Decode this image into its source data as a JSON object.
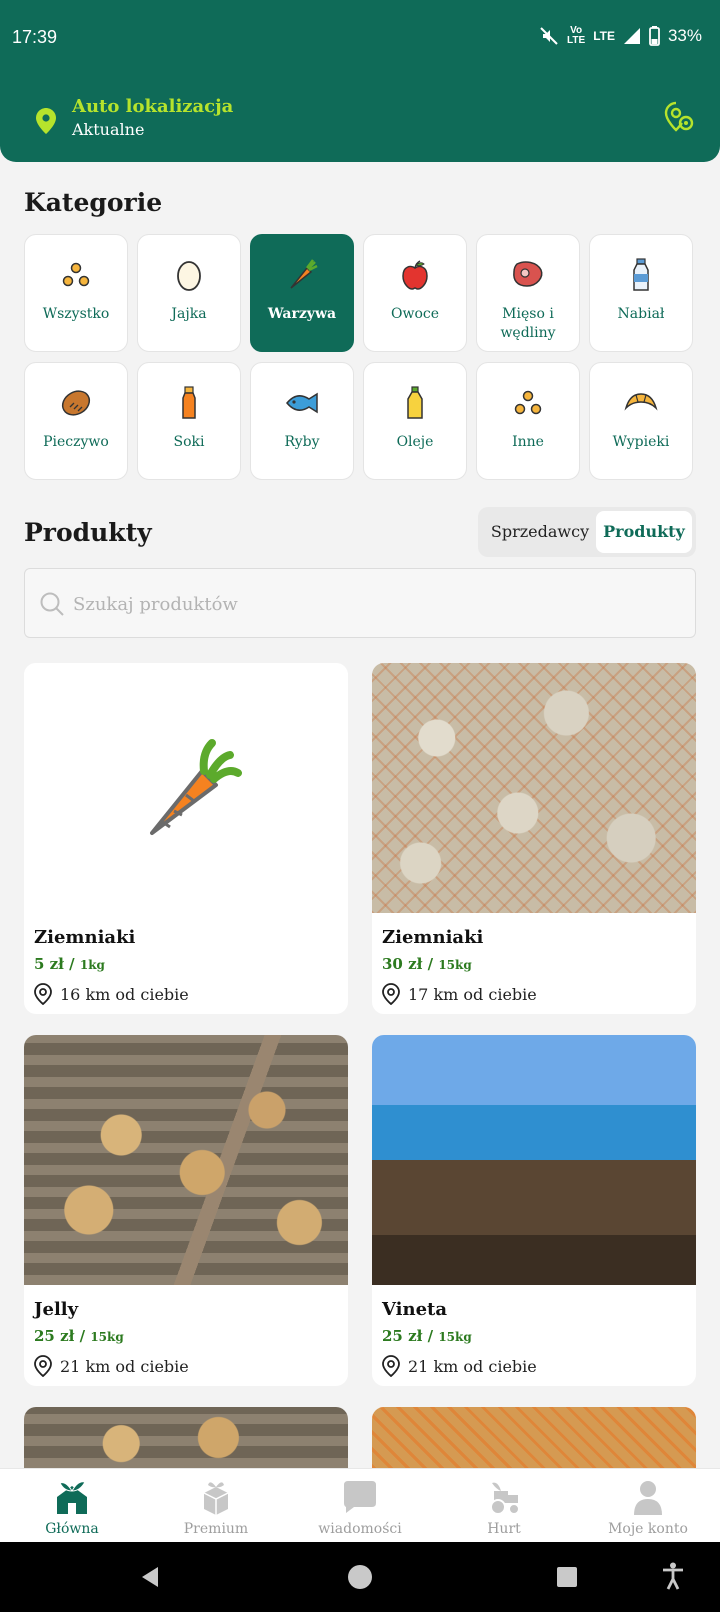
{
  "status": {
    "time": "17:39",
    "battery": "33%",
    "volte_top": "Vo",
    "volte_bottom": "LTE",
    "lte": "LTE"
  },
  "location": {
    "title": "Auto lokalizacja",
    "subtitle": "Aktualne"
  },
  "categories_title": "Kategorie",
  "categories": [
    {
      "label": "Wszystko",
      "icon": "dots-icon"
    },
    {
      "label": "Jajka",
      "icon": "egg-icon"
    },
    {
      "label": "Warzywa",
      "icon": "carrot-icon",
      "active": true
    },
    {
      "label": "Owoce",
      "icon": "apple-icon"
    },
    {
      "label": "Mięso i wędliny",
      "icon": "meat-icon"
    },
    {
      "label": "Nabiał",
      "icon": "milk-bottle-icon"
    },
    {
      "label": "Pieczywo",
      "icon": "bread-icon"
    },
    {
      "label": "Soki",
      "icon": "juice-icon"
    },
    {
      "label": "Ryby",
      "icon": "fish-icon"
    },
    {
      "label": "Oleje",
      "icon": "oil-icon"
    },
    {
      "label": "Inne",
      "icon": "dots-icon"
    },
    {
      "label": "Wypieki",
      "icon": "croissant-icon"
    }
  ],
  "products_title": "Produkty",
  "toggle": {
    "sellers": "Sprzedawcy",
    "products": "Produkty"
  },
  "search": {
    "placeholder": "Szukaj produktów"
  },
  "products": [
    {
      "name": "Ziemniaki",
      "price": "5 zł",
      "unit": "1kg",
      "distance": "16 km od ciebie"
    },
    {
      "name": "Ziemniaki",
      "price": "30 zł",
      "unit": "15kg",
      "distance": "17 km od ciebie"
    },
    {
      "name": "Jelly",
      "price": "25 zł",
      "unit": "15kg",
      "distance": "21 km od ciebie"
    },
    {
      "name": "Vineta",
      "price": "25 zł",
      "unit": "15kg",
      "distance": "21 km od ciebie"
    }
  ],
  "nav": [
    {
      "label": "Główna",
      "active": true
    },
    {
      "label": "Premium"
    },
    {
      "label": "wiadomości"
    },
    {
      "label": "Hurt"
    },
    {
      "label": "Moje konto"
    }
  ],
  "colors": {
    "brand": "#0f6b58",
    "accent": "#b6e32c",
    "price": "#2c7a1f"
  }
}
